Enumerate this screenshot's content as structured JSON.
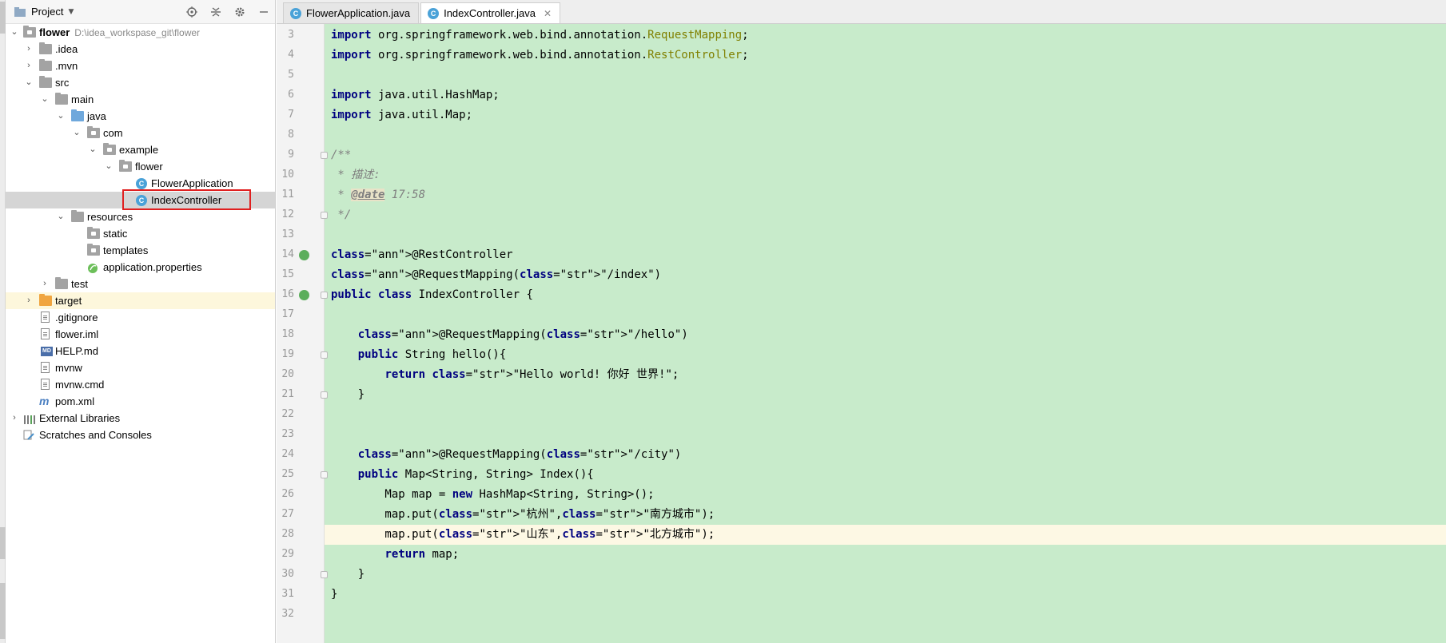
{
  "project_panel": {
    "title": "Project",
    "tree": [
      {
        "label": "flower",
        "path": "D:\\idea_workspase_git\\flower"
      },
      {
        "label": ".idea"
      },
      {
        "label": ".mvn"
      },
      {
        "label": "src"
      },
      {
        "label": "main"
      },
      {
        "label": "java"
      },
      {
        "label": "com"
      },
      {
        "label": "example"
      },
      {
        "label": "flower"
      },
      {
        "label": "FlowerApplication"
      },
      {
        "label": "IndexController"
      },
      {
        "label": "resources"
      },
      {
        "label": "static"
      },
      {
        "label": "templates"
      },
      {
        "label": "application.properties"
      },
      {
        "label": "test"
      },
      {
        "label": "target"
      },
      {
        "label": ".gitignore"
      },
      {
        "label": "flower.iml"
      },
      {
        "label": "HELP.md"
      },
      {
        "label": "mvnw"
      },
      {
        "label": "mvnw.cmd"
      },
      {
        "label": "pom.xml"
      },
      {
        "label": "External Libraries"
      },
      {
        "label": "Scratches and Consoles"
      }
    ]
  },
  "editor": {
    "tabs": [
      {
        "label": "FlowerApplication.java"
      },
      {
        "label": "IndexController.java"
      }
    ],
    "lines": [
      {
        "n": "3",
        "text": "import org.springframework.web.bind.annotation.RequestMapping;"
      },
      {
        "n": "4",
        "text": "import org.springframework.web.bind.annotation.RestController;"
      },
      {
        "n": "5",
        "text": ""
      },
      {
        "n": "6",
        "text": "import java.util.HashMap;"
      },
      {
        "n": "7",
        "text": "import java.util.Map;"
      },
      {
        "n": "8",
        "text": ""
      },
      {
        "n": "9",
        "text": "/**"
      },
      {
        "n": "10",
        "text": " * 描述:"
      },
      {
        "n": "11",
        "text": " * @date 17:58"
      },
      {
        "n": "12",
        "text": " */"
      },
      {
        "n": "13",
        "text": ""
      },
      {
        "n": "14",
        "text": "@RestController"
      },
      {
        "n": "15",
        "text": "@RequestMapping(\"/index\")"
      },
      {
        "n": "16",
        "text": "public class IndexController {"
      },
      {
        "n": "17",
        "text": ""
      },
      {
        "n": "18",
        "text": "    @RequestMapping(\"/hello\")"
      },
      {
        "n": "19",
        "text": "    public String hello(){"
      },
      {
        "n": "20",
        "text": "        return \"Hello world! 你好 世界!\";"
      },
      {
        "n": "21",
        "text": "    }"
      },
      {
        "n": "22",
        "text": ""
      },
      {
        "n": "23",
        "text": ""
      },
      {
        "n": "24",
        "text": "    @RequestMapping(\"/city\")"
      },
      {
        "n": "25",
        "text": "    public Map<String, String> Index(){"
      },
      {
        "n": "26",
        "text": "        Map map = new HashMap<String, String>();"
      },
      {
        "n": "27",
        "text": "        map.put(\"杭州\",\"南方城市\");"
      },
      {
        "n": "28",
        "text": "        map.put(\"山东\",\"北方城市\");"
      },
      {
        "n": "29",
        "text": "        return map;"
      },
      {
        "n": "30",
        "text": "    }"
      },
      {
        "n": "31",
        "text": "}"
      },
      {
        "n": "32",
        "text": ""
      }
    ],
    "current_line": "28"
  },
  "colors": {
    "editor_background": "#c8ebcb",
    "selected_row": "#d5d5d5",
    "highlight_box": "#e02020",
    "keyword": "#000080",
    "annotation": "#808000",
    "string": "#008000"
  }
}
